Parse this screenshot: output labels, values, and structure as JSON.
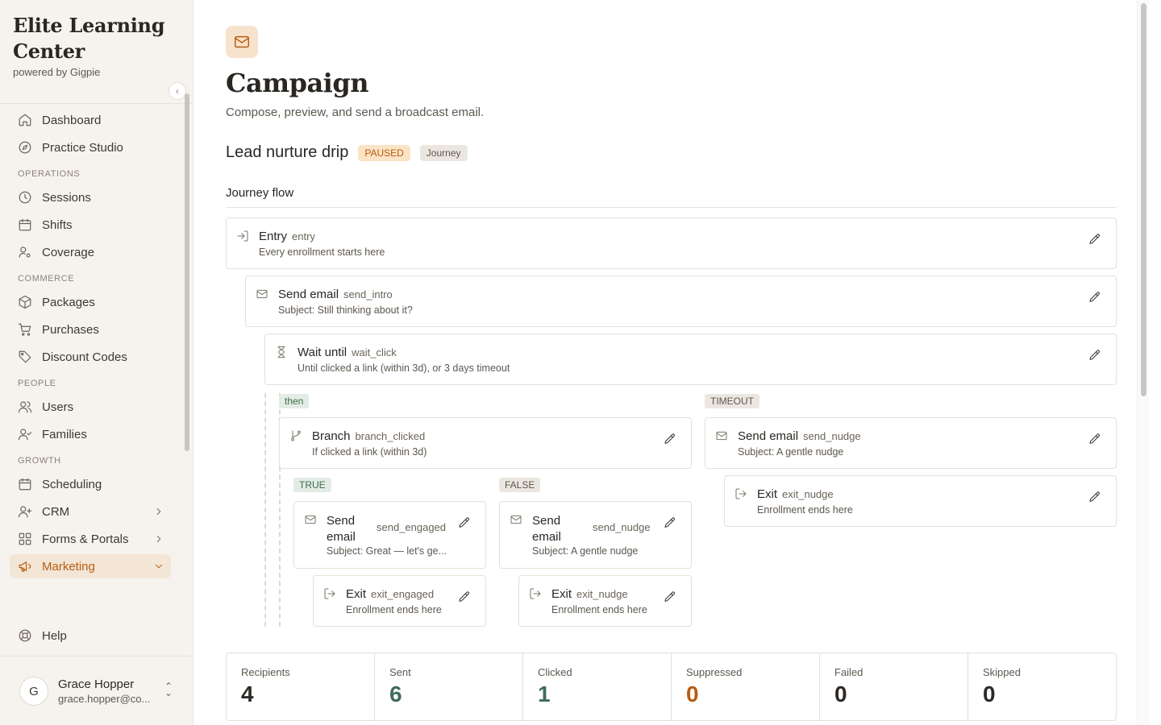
{
  "brand": {
    "title": "Elite Learning Center",
    "subtitle": "powered by Gigpie"
  },
  "nav": {
    "dashboard": "Dashboard",
    "practice_studio": "Practice Studio",
    "operations_header": "OPERATIONS",
    "sessions": "Sessions",
    "shifts": "Shifts",
    "coverage": "Coverage",
    "commerce_header": "COMMERCE",
    "packages": "Packages",
    "purchases": "Purchases",
    "discount_codes": "Discount Codes",
    "people_header": "PEOPLE",
    "users": "Users",
    "families": "Families",
    "growth_header": "GROWTH",
    "scheduling": "Scheduling",
    "crm": "CRM",
    "forms_portals": "Forms & Portals",
    "marketing": "Marketing",
    "help": "Help"
  },
  "user": {
    "initial": "G",
    "name": "Grace Hopper",
    "email": "grace.hopper@co..."
  },
  "page": {
    "title": "Campaign",
    "subtitle": "Compose, preview, and send a broadcast email.",
    "campaign_name": "Lead nurture drip",
    "status_badge": "PAUSED",
    "type_badge": "Journey",
    "flow_title": "Journey flow"
  },
  "flow": {
    "entry": {
      "title": "Entry",
      "id": "entry",
      "desc": "Every enrollment starts here"
    },
    "send_intro": {
      "title": "Send email",
      "id": "send_intro",
      "desc": "Subject: Still thinking about it?"
    },
    "wait_click": {
      "title": "Wait until",
      "id": "wait_click",
      "desc": "Until clicked a link (within 3d), or 3 days timeout"
    },
    "then_label": "then",
    "timeout_label": "TIMEOUT",
    "branch": {
      "title": "Branch",
      "id": "branch_clicked",
      "desc": "If clicked a link (within 3d)"
    },
    "timeout_send": {
      "title": "Send email",
      "id": "send_nudge",
      "desc": "Subject: A gentle nudge"
    },
    "timeout_exit": {
      "title": "Exit",
      "id": "exit_nudge",
      "desc": "Enrollment ends here"
    },
    "true_label": "TRUE",
    "false_label": "FALSE",
    "true_send": {
      "title": "Send email",
      "id": "send_engaged",
      "desc": "Subject: Great — let's ge..."
    },
    "true_exit": {
      "title": "Exit",
      "id": "exit_engaged",
      "desc": "Enrollment ends here"
    },
    "false_send": {
      "title": "Send email",
      "id": "send_nudge",
      "desc": "Subject: A gentle nudge"
    },
    "false_exit": {
      "title": "Exit",
      "id": "exit_nudge",
      "desc": "Enrollment ends here"
    }
  },
  "stats": [
    {
      "label": "Recipients",
      "value": "4",
      "color": "#2d2a26"
    },
    {
      "label": "Sent",
      "value": "6",
      "color": "#3e6b5a"
    },
    {
      "label": "Clicked",
      "value": "1",
      "color": "#3e6b5a"
    },
    {
      "label": "Suppressed",
      "value": "0",
      "color": "#b85c10"
    },
    {
      "label": "Failed",
      "value": "0",
      "color": "#2d2a26"
    },
    {
      "label": "Skipped",
      "value": "0",
      "color": "#2d2a26"
    }
  ],
  "colors": {
    "accent": "#b85c10",
    "active_bg": "#f3e6d6",
    "sidebar_bg": "#f6f3ee"
  }
}
